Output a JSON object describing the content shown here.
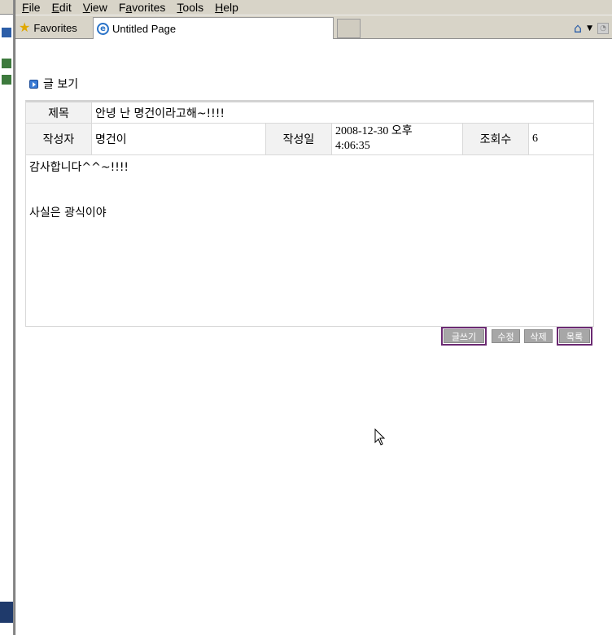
{
  "menu": {
    "items": [
      {
        "first": "F",
        "rest": "ile"
      },
      {
        "first": "E",
        "rest": "dit"
      },
      {
        "first": "V",
        "rest": "iew"
      },
      {
        "first": "Fa",
        "rest": "vorites",
        "underline_index": 1
      },
      {
        "first": "T",
        "rest": "ools"
      },
      {
        "first": "H",
        "rest": "elp"
      }
    ],
    "file": "File",
    "edit": "Edit",
    "view": "View",
    "favorites": "Favorites",
    "tools": "Tools",
    "help": "Help"
  },
  "toolbar": {
    "favorites_label": "Favorites",
    "tab_title": "Untitled Page"
  },
  "page": {
    "section_title": "글 보기",
    "post": {
      "subject_label": "제목",
      "subject_value": "안녕 난 명건이라고해~!!!!",
      "author_label": "작성자",
      "author_value": "명건이",
      "date_label": "작성일",
      "date_value_line1": "2008-12-30 오후",
      "date_value_line2": "4:06:35",
      "views_label": "조회수",
      "views_value": "6",
      "body_line1": "감사합니다^^~!!!!",
      "body_line2": "사실은 광식이야"
    },
    "buttons": {
      "write": "글쓰기",
      "edit": "수정",
      "delete": "삭제",
      "list": "목록"
    }
  },
  "colors": {
    "chrome_bg": "#d8d4c8",
    "label_bg": "#f2f2f2",
    "button_bg": "#a7a7a7",
    "button_frame": "#6b2a72",
    "bullet_blue": "#3a7bd5"
  }
}
